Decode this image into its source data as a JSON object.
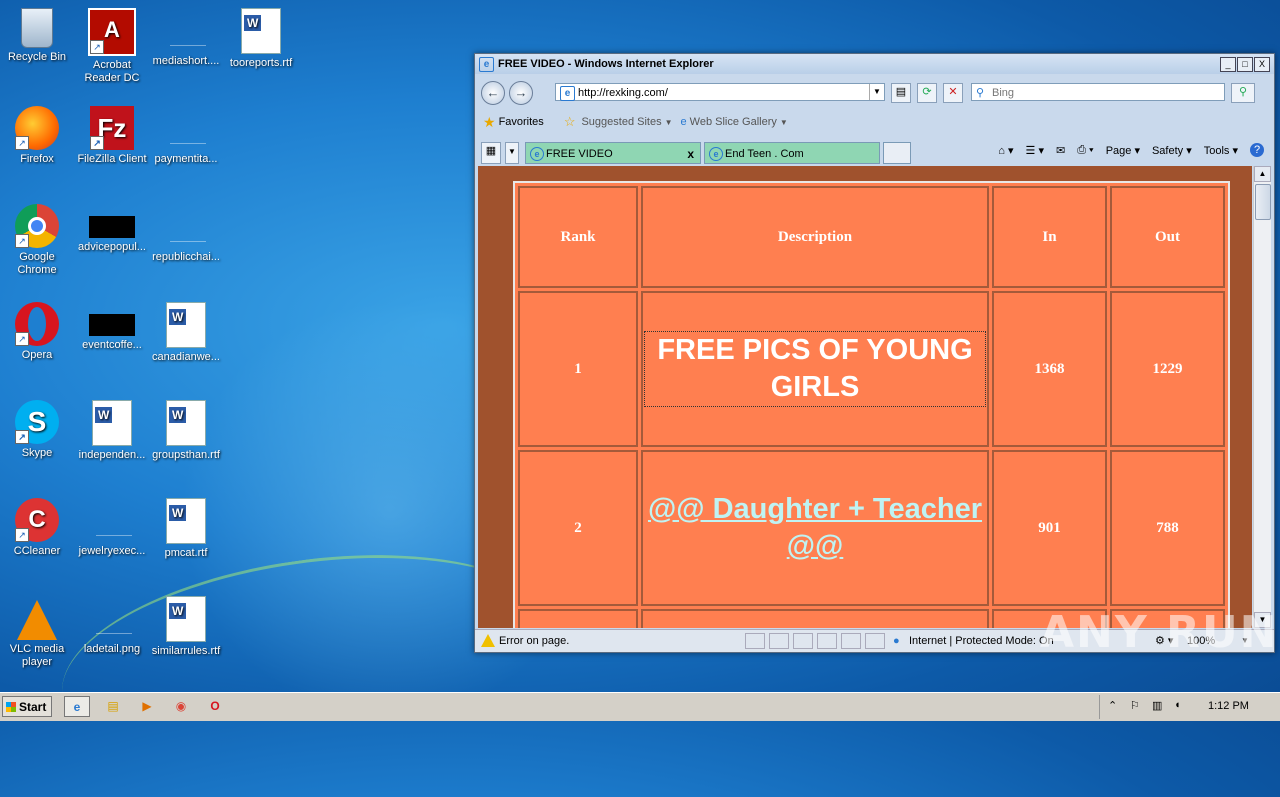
{
  "desktop": {
    "icons": [
      {
        "label": "Recycle Bin"
      },
      {
        "label": "Acrobat Reader DC"
      },
      {
        "label": "mediashort...."
      },
      {
        "label": "tooreports.rtf"
      },
      {
        "label": "Firefox"
      },
      {
        "label": "FileZilla Client"
      },
      {
        "label": "paymentita..."
      },
      {
        "label": "Google Chrome"
      },
      {
        "label": "advicepopul..."
      },
      {
        "label": "republicchai..."
      },
      {
        "label": "Opera"
      },
      {
        "label": "eventcoffe..."
      },
      {
        "label": "canadianwe..."
      },
      {
        "label": "Skype"
      },
      {
        "label": "independen..."
      },
      {
        "label": "groupsthan.rtf"
      },
      {
        "label": "CCleaner"
      },
      {
        "label": "jewelryexec..."
      },
      {
        "label": "pmcat.rtf"
      },
      {
        "label": "VLC media player"
      },
      {
        "label": "ladetail.png"
      },
      {
        "label": "similarrules.rtf"
      }
    ]
  },
  "browser": {
    "title": "FREE VIDEO - Windows Internet Explorer",
    "window_buttons": {
      "minimize": "_",
      "maximize": "□",
      "close": "X"
    },
    "address": "http://rexking.com/",
    "search_placeholder": "Bing",
    "favorites": {
      "label": "Favorites",
      "suggested": "Suggested Sites",
      "webslice": "Web Slice Gallery"
    },
    "tabs": [
      {
        "label": "FREE VIDEO",
        "close": "x"
      },
      {
        "label": "End Teen . Com"
      }
    ],
    "commands": {
      "page": "Page",
      "safety": "Safety",
      "tools": "Tools",
      "help": "?"
    },
    "status": {
      "message": "Error on page.",
      "zone": "Internet | Protected Mode: On",
      "zoom": "100%"
    }
  },
  "page": {
    "table": {
      "headers": [
        "Rank",
        "Description",
        "In",
        "Out"
      ],
      "rows": [
        {
          "rank": "1",
          "description": "FREE PICS OF YOUNG GIRLS",
          "in": "1368",
          "out": "1229"
        },
        {
          "rank": "2",
          "description": "@@ Daughter + Teacher @@",
          "in": "901",
          "out": "788"
        }
      ]
    }
  },
  "taskbar": {
    "start_label": "Start",
    "time": "1:12 PM"
  },
  "watermark": "ANY  RUN",
  "colors": {
    "table_bg": "#ff7f50",
    "page_bg": "#a0522d",
    "link": "#bff3f3"
  }
}
